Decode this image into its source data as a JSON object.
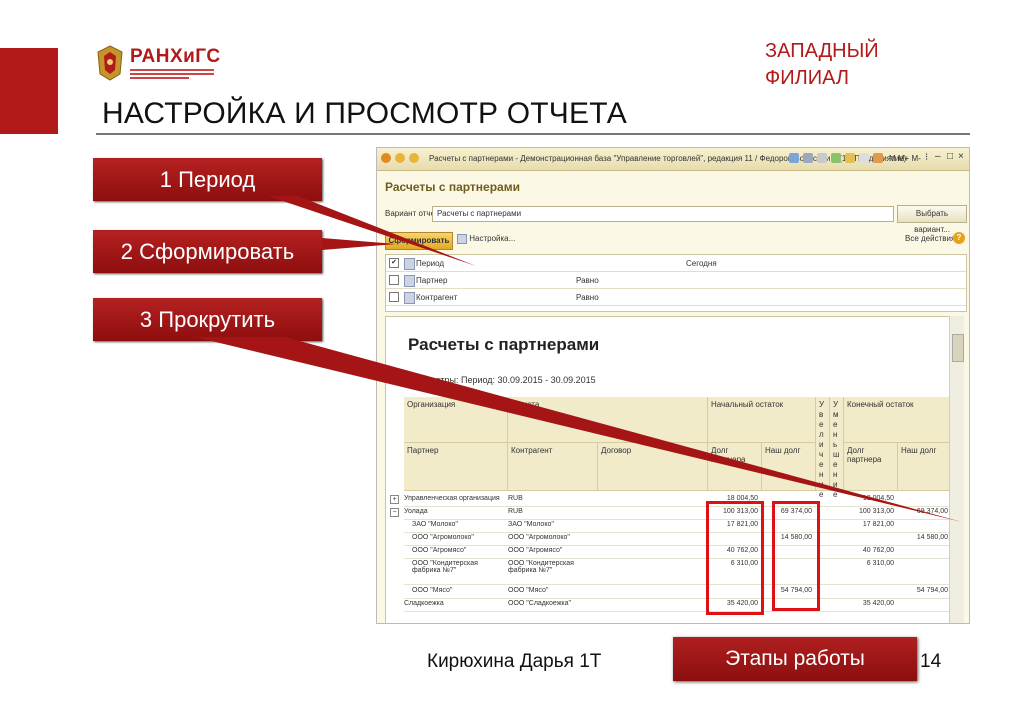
{
  "header": {
    "brand": "РАНХиГС",
    "branch_line1": "ЗАПАДНЫЙ",
    "branch_line2": "ФИЛИАЛ",
    "title": "НАСТРОЙКА И ПРОСМОТР ОТЧЕТА"
  },
  "callouts": [
    {
      "label": "1 Период"
    },
    {
      "label": "2 Сформировать"
    },
    {
      "label": "3 Прокрутить"
    }
  ],
  "window": {
    "title": "Расчеты с партнерами - Демонстрационная база \"Управление торговлей\", редакция 11 / Федоров Борис Ми... (1С:Предприятие)",
    "toolbar_right": "M M+ M-",
    "form_title": "Расчеты с партнерами",
    "variant_label": "Вариант отчета:",
    "variant_value": "Расчеты с партнерами",
    "choose_variant": "Выбрать вариант...",
    "generate_button": "Сформировать",
    "settings_link": "Настройка...",
    "all_actions": "Все действия ▾",
    "help": "?"
  },
  "params": [
    {
      "name": "Период",
      "cond": "",
      "value": "Сегодня",
      "checked": "✔"
    },
    {
      "name": "Партнер",
      "cond": "Равно",
      "value": "",
      "checked": ""
    },
    {
      "name": "Контрагент",
      "cond": "Равно",
      "value": "",
      "checked": ""
    }
  ],
  "report": {
    "title": "Расчеты с партнерами",
    "params_text": "Параметры:   Период: 30.09.2015 - 30.09.2015",
    "headers": {
      "org": "Организация",
      "currency": "Валюта",
      "start_balance": "Начальный остаток",
      "increase": "Увеличение",
      "decrease": "Уменьшение",
      "end_balance": "Конечный остаток",
      "partner": "Партнер",
      "counterparty": "Контрагент",
      "contract": "Договор",
      "partner_debt": "Долг партнера",
      "our_debt": "Наш долг",
      "partner_debt2": "Долг партнера",
      "our_debt2": "Наш долг"
    },
    "rows": [
      {
        "exp": "+",
        "a": "Управленческая организация",
        "b": "RUB",
        "s1": "18 004,50",
        "s2": "",
        "e1": "18 004,50",
        "e2": ""
      },
      {
        "exp": "−",
        "a": "Уолада",
        "b": "RUB",
        "s1": "100 313,00",
        "s2": "69 374,00",
        "e1": "100 313,00",
        "e2": "69 374,00"
      },
      {
        "exp": "",
        "a": "ЗАО \"Молоко\"",
        "b": "ЗАО \"Молоко\"",
        "s1": "17 821,00",
        "s2": "",
        "e1": "17 821,00",
        "e2": ""
      },
      {
        "exp": "",
        "a": "ООО \"Агромолоко\"",
        "b": "ООО \"Агромолоко\"",
        "s1": "",
        "s2": "14 580,00",
        "e1": "",
        "e2": "14 580,00"
      },
      {
        "exp": "",
        "a": "ООО \"Агромясо\"",
        "b": "ООО \"Агромясо\"",
        "s1": "40 762,00",
        "s2": "",
        "e1": "40 762,00",
        "e2": ""
      },
      {
        "exp": "",
        "a": "ООО \"Кондитерская фабрика №7\"",
        "b": "ООО \"Кондитерская фабрика №7\"",
        "s1": "6 310,00",
        "s2": "",
        "e1": "6 310,00",
        "e2": ""
      },
      {
        "exp": "",
        "a": "ООО \"Мясо\"",
        "b": "ООО \"Мясо\"",
        "s1": "",
        "s2": "54 794,00",
        "e1": "",
        "e2": "54 794,00"
      },
      {
        "exp": "",
        "a": "Сладкоежка",
        "b": "ООО \"Сладкоежка\"",
        "s1": "35 420,00",
        "s2": "",
        "e1": "35 420,00",
        "e2": ""
      }
    ]
  },
  "footer": {
    "author": "Кирюхина Дарья 1Т",
    "stages_button": "Этапы работы",
    "page": "14"
  },
  "colors": {
    "accent_red": "#b21a1a",
    "highlight_box": "#d11111",
    "window_bg": "#fbf8e6"
  }
}
